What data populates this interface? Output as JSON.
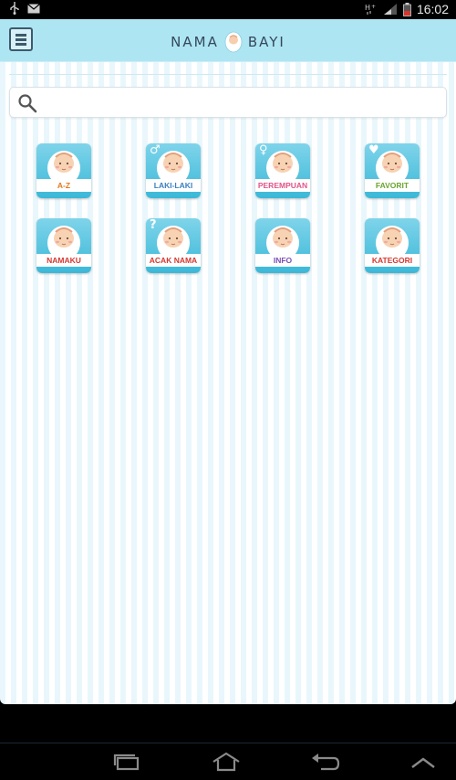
{
  "status_bar": {
    "time": "16:02",
    "left_icons": [
      "usb-icon",
      "gmail-icon"
    ],
    "right_icons": [
      "hplus-data-icon",
      "signal-icon",
      "battery-icon"
    ]
  },
  "header": {
    "title_left": "NAMA",
    "title_right": "BAYI",
    "menu_icon": "menu-icon"
  },
  "search": {
    "placeholder": "",
    "value": ""
  },
  "tiles": [
    {
      "label": "A-Z",
      "label_color": "#e07a1f",
      "badge": ""
    },
    {
      "label": "LAKI-LAKI",
      "label_color": "#3a7fbf",
      "badge": "♂"
    },
    {
      "label": "PEREMPUAN",
      "label_color": "#e0548a",
      "badge": "♀"
    },
    {
      "label": "FAVORIT",
      "label_color": "#6aa530",
      "badge": "♥"
    },
    {
      "label": "NAMAKU",
      "label_color": "#d6362e",
      "badge": ""
    },
    {
      "label": "ACAK NAMA",
      "label_color": "#d6362e",
      "badge": "?"
    },
    {
      "label": "INFO",
      "label_color": "#7a4fb5",
      "badge": ""
    },
    {
      "label": "KATEGORI",
      "label_color": "#d6362e",
      "badge": ""
    }
  ],
  "nav_bar": {
    "icons": [
      "recent-apps-icon",
      "home-icon",
      "back-icon",
      "menu-up-icon"
    ]
  }
}
